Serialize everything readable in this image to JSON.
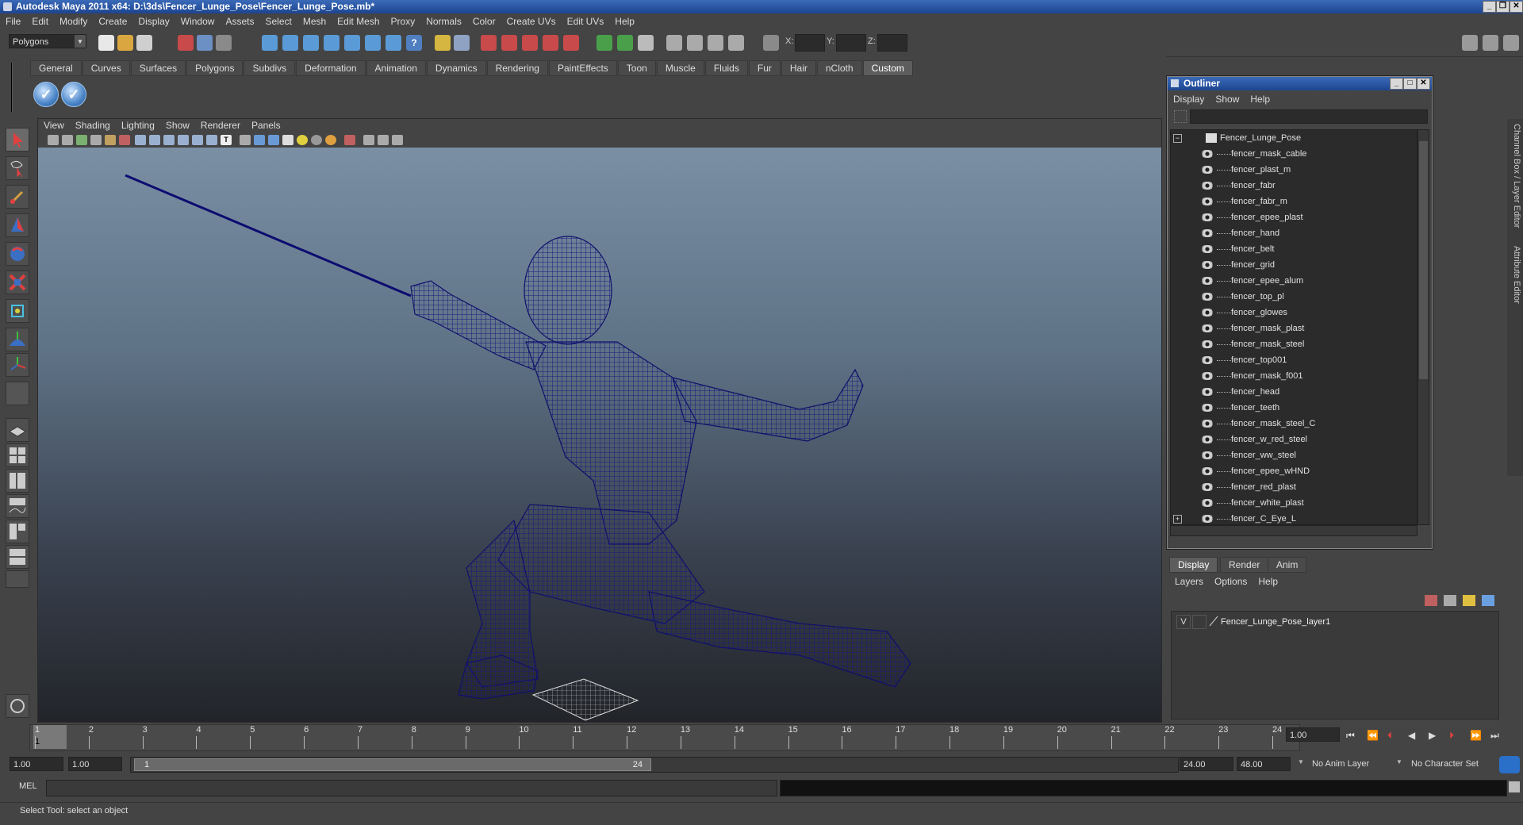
{
  "title": "Autodesk Maya 2011 x64: D:\\3ds\\Fencer_Lunge_Pose\\Fencer_Lunge_Pose.mb*",
  "menu": [
    "File",
    "Edit",
    "Modify",
    "Create",
    "Display",
    "Window",
    "Assets",
    "Select",
    "Mesh",
    "Edit Mesh",
    "Proxy",
    "Normals",
    "Color",
    "Create UVs",
    "Edit UVs",
    "Help"
  ],
  "mode_selector": "Polygons",
  "coords": {
    "x_label": "X:",
    "y_label": "Y:",
    "z_label": "Z:"
  },
  "shelf_tabs": [
    "General",
    "Curves",
    "Surfaces",
    "Polygons",
    "Subdivs",
    "Deformation",
    "Animation",
    "Dynamics",
    "Rendering",
    "PaintEffects",
    "Toon",
    "Muscle",
    "Fluids",
    "Fur",
    "Hair",
    "nCloth",
    "Custom"
  ],
  "shelf_active": "Custom",
  "viewport_menu": [
    "View",
    "Shading",
    "Lighting",
    "Show",
    "Renderer",
    "Panels"
  ],
  "outliner": {
    "title": "Outliner",
    "menu": [
      "Display",
      "Show",
      "Help"
    ],
    "root": "Fencer_Lunge_Pose",
    "items": [
      "fencer_mask_cable",
      "fencer_plast_m",
      "fencer_fabr",
      "fencer_fabr_m",
      "fencer_epee_plast",
      "fencer_hand",
      "fencer_belt",
      "fencer_grid",
      "fencer_epee_alum",
      "fencer_top_pl",
      "fencer_glowes",
      "fencer_mask_plast",
      "fencer_mask_steel",
      "fencer_top001",
      "fencer_mask_f001",
      "fencer_head",
      "fencer_teeth",
      "fencer_mask_steel_C",
      "fencer_w_red_steel",
      "fencer_ww_steel",
      "fencer_epee_wHND",
      "fencer_red_plast",
      "fencer_white_plast",
      "fencer_C_Eye_L"
    ]
  },
  "layer_editor": {
    "tabs": [
      "Display",
      "Render",
      "Anim"
    ],
    "active_tab": "Display",
    "menu": [
      "Layers",
      "Options",
      "Help"
    ],
    "layer_visibility": "V",
    "layer_name": "Fencer_Lunge_Pose_layer1"
  },
  "side_tabs": [
    "Channel Box / Layer Editor",
    "Attribute Editor"
  ],
  "timeline": {
    "ticks": [
      "1",
      "2",
      "3",
      "4",
      "5",
      "6",
      "7",
      "8",
      "9",
      "10",
      "11",
      "12",
      "13",
      "14",
      "15",
      "16",
      "17",
      "18",
      "19",
      "20",
      "21",
      "22",
      "23",
      "24"
    ],
    "current_frame_label": "1",
    "current_time": "1.00"
  },
  "range": {
    "start": "1.00",
    "playback_start": "1.00",
    "slider_start": "1",
    "slider_end": "24",
    "playback_end": "24.00",
    "end": "48.00",
    "anim_layer": "No Anim Layer",
    "character_set": "No Character Set"
  },
  "command": {
    "label": "MEL"
  },
  "status": "Select Tool: select an object"
}
